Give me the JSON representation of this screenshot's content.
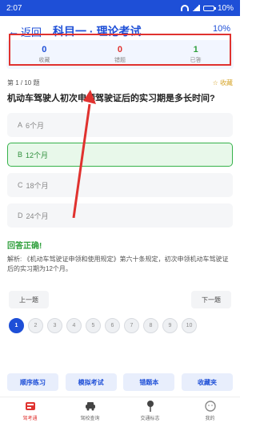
{
  "status": {
    "time": "2:07",
    "battery": "10%"
  },
  "header": {
    "back_label": "返回",
    "title": "科目一 · 理论考试",
    "progress": "10%"
  },
  "stats": [
    {
      "value": "0",
      "label": "收藏",
      "color": "#1e4fd7"
    },
    {
      "value": "0",
      "label": "错题",
      "color": "#e0322f"
    },
    {
      "value": "1",
      "label": "已答",
      "color": "#2f9f3c"
    }
  ],
  "question": {
    "index": "第 1 / 10 题",
    "favorite_label": "☆ 收藏",
    "text": "机动车驾驶人初次申领驾驶证后的实习期是多长时间?",
    "options": [
      {
        "letter": "A",
        "text": "6个月",
        "state": "normal"
      },
      {
        "letter": "B",
        "text": "12个月",
        "state": "correct"
      },
      {
        "letter": "C",
        "text": "18个月",
        "state": "normal"
      },
      {
        "letter": "D",
        "text": "24个月",
        "state": "normal"
      }
    ],
    "result": "回答正确!",
    "explanation": "解析: 《机动车驾驶证申领和使用规定》第六十条规定，初次申领机动车驾驶证后的实习期为12个月。"
  },
  "nav": {
    "prev": "上一题",
    "next": "下一题"
  },
  "pages": [
    "1",
    "2",
    "3",
    "4",
    "5",
    "6",
    "7",
    "8",
    "9",
    "10"
  ],
  "actions": [
    "顺序练习",
    "模拟考试",
    "错题本",
    "收藏夹"
  ],
  "tabs": [
    {
      "label": "驾考通",
      "icon": "exam-icon",
      "active": true
    },
    {
      "label": "驾校查询",
      "icon": "car-icon",
      "active": false
    },
    {
      "label": "交通标志",
      "icon": "sign-icon",
      "active": false
    },
    {
      "label": "我的",
      "icon": "user-icon",
      "active": false
    }
  ]
}
